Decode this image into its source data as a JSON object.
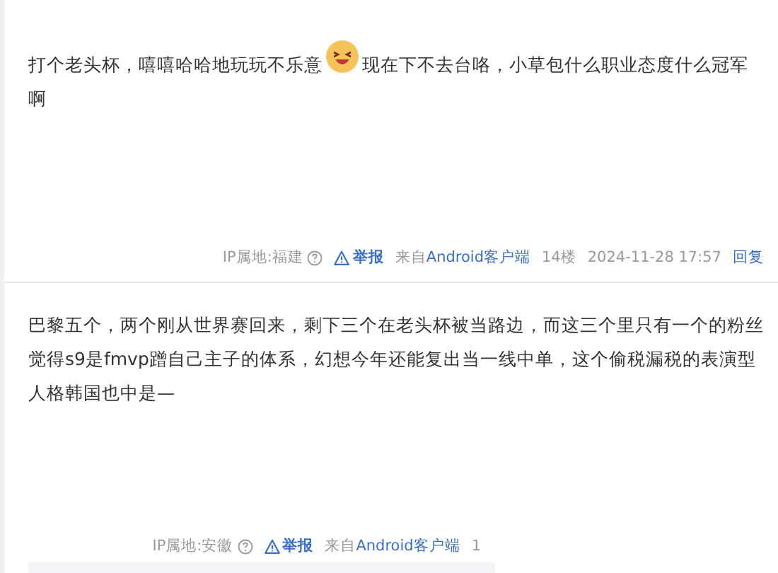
{
  "posts": [
    {
      "segments": [
        {
          "kind": "text",
          "text": "打个老头杯，嘻嘻哈哈地玩玩不乐意"
        },
        {
          "kind": "emoji"
        },
        {
          "kind": "text",
          "text": "现在下不去台咯，小草包什么职业态度什么冠军啊"
        }
      ],
      "footer": {
        "ip": "IP属地:福建",
        "report": "举报",
        "source_prefix": "来自",
        "source": "Android客户端",
        "floor": "14楼",
        "time": "2024-11-28 17:57",
        "reply": "回复"
      }
    },
    {
      "segments": [
        {
          "kind": "text",
          "text": "巴黎五个，两个刚从世界赛回来，剩下三个在老头杯被当路边，而这三个里只有一个的粉丝觉得s9是fmvp蹭自己主子的体系，幻想今年还能复出当一线中单，这个偷税漏税的表演型人格韩国也中是—"
        }
      ],
      "footer": {
        "ip": "IP属地:安徽",
        "report": "举报",
        "source_prefix": "来自",
        "source": "Android客户端",
        "floor": "1"
      }
    }
  ]
}
